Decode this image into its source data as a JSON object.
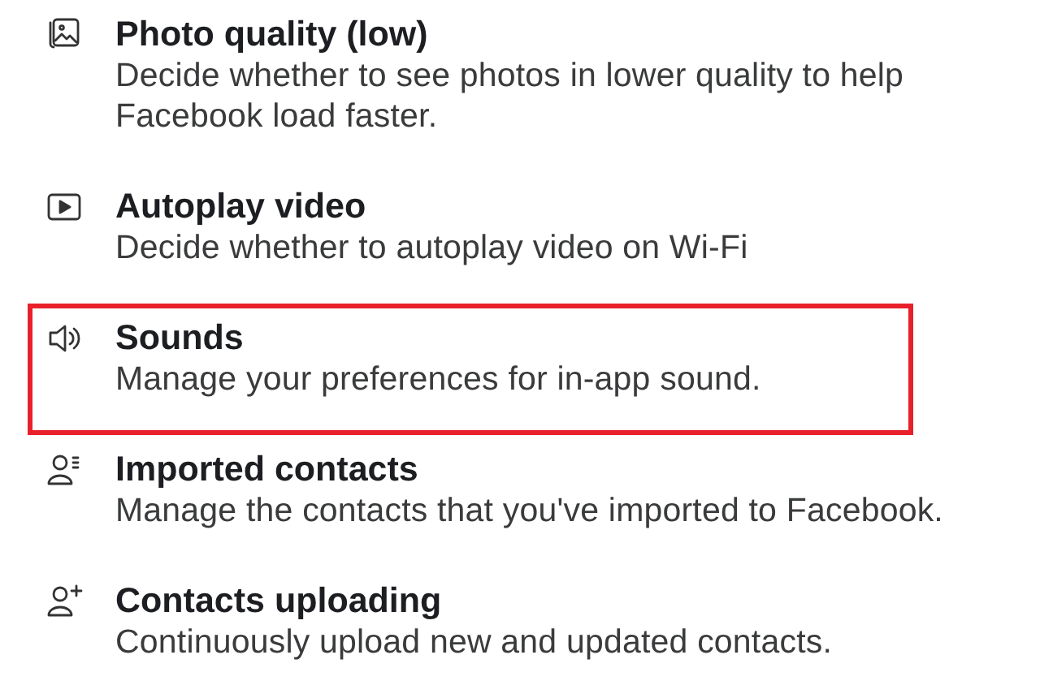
{
  "settings": [
    {
      "kind": "photo",
      "title": "Photo quality (low)",
      "description": "Decide whether to see photos in lower quality to help Facebook load faster.",
      "highlighted": false
    },
    {
      "kind": "video",
      "title": "Autoplay video",
      "description": "Decide whether to autoplay video on Wi-Fi",
      "highlighted": false
    },
    {
      "kind": "sound",
      "title": "Sounds",
      "description": "Manage your preferences for in-app sound.",
      "highlighted": true
    },
    {
      "kind": "contacts",
      "title": "Imported contacts",
      "description": "Manage the contacts that you've imported to Facebook.",
      "highlighted": false
    },
    {
      "kind": "upload",
      "title": "Contacts uploading",
      "description": "Continuously upload new and updated contacts.",
      "highlighted": false
    }
  ]
}
